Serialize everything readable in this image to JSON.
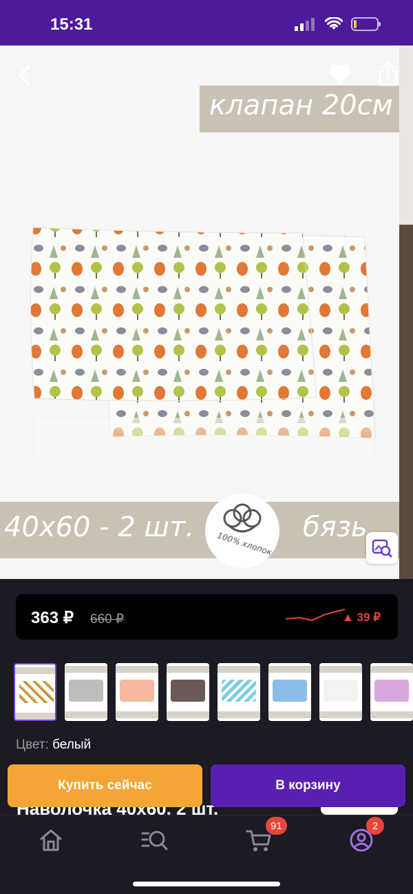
{
  "status_bar": {
    "time": "15:31"
  },
  "product_image": {
    "banner_top": "клапан 20см",
    "banner_size": "40х60 - 2 шт.",
    "banner_fabric": "бязь",
    "cotton_badge": "100% хлопок"
  },
  "price": {
    "current": "363 ₽",
    "old": "660 ₽",
    "delta": "▲ 39 ₽",
    "trend_direction": "up"
  },
  "thumbnails": [
    {
      "name": "forest-print",
      "colors": [
        "#ffffff",
        "#e0773a"
      ],
      "selected": true
    },
    {
      "name": "grey",
      "colors": [
        "#bdbdbd"
      ],
      "selected": false
    },
    {
      "name": "peach",
      "colors": [
        "#f6b9a0"
      ],
      "selected": false
    },
    {
      "name": "brown",
      "colors": [
        "#6b5953"
      ],
      "selected": false
    },
    {
      "name": "zigzag",
      "colors": [
        "#7ccfe0"
      ],
      "selected": false
    },
    {
      "name": "clouds",
      "colors": [
        "#8bbde8"
      ],
      "selected": false
    },
    {
      "name": "white-print",
      "colors": [
        "#f3f3f3"
      ],
      "selected": false
    },
    {
      "name": "lilac",
      "colors": [
        "#d9a6e0"
      ],
      "selected": false
    }
  ],
  "color": {
    "label": "Цвет:",
    "value": "белый"
  },
  "title_peek": "Наволочка 40х60, 2 шт.",
  "actions": {
    "buy_now": "Купить сейчас",
    "add_to_cart": "В корзину"
  },
  "tab_bar": {
    "cart_badge": "91",
    "profile_badge": "2"
  },
  "colors": {
    "brand_purple": "#4d1a9c",
    "button_orange": "#f4a535",
    "button_purple": "#5a1fb0",
    "price_alert": "#e8453c"
  }
}
